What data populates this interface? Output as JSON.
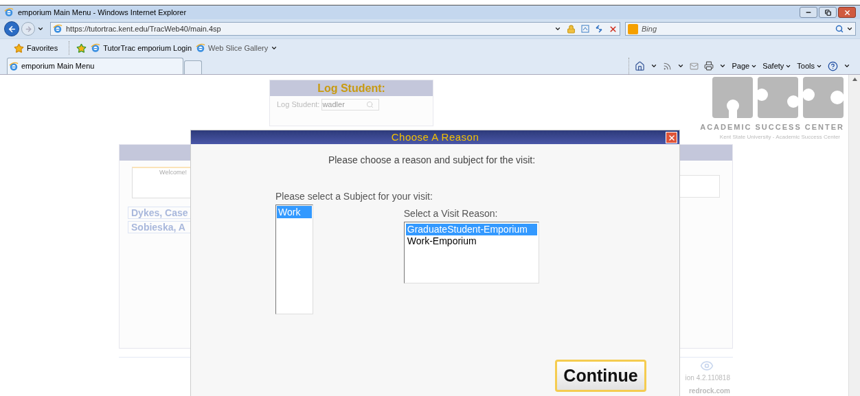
{
  "window": {
    "title": "emporium Main Menu - Windows Internet Explorer"
  },
  "address_bar": {
    "url": "https://tutortrac.kent.edu/TracWeb40/main.4sp",
    "search_placeholder": "Bing"
  },
  "favorites_bar": {
    "label": "Favorites",
    "links": [
      "TutorTrac emporium Login",
      "Web Slice Gallery"
    ]
  },
  "tabs": [
    {
      "label": "emporium Main Menu",
      "selected": true
    }
  ],
  "command_bar": [
    "Page",
    "Safety",
    "Tools"
  ],
  "page": {
    "log_student": {
      "title": "Log Student:",
      "label": "Log Student:",
      "value": "wadler"
    },
    "logo": {
      "title": "ACADEMIC SUCCESS CENTER",
      "subtitle": "Kent State University - Academic Success Center"
    },
    "welcome": "Welcome!",
    "students": [
      "Dykes, Case",
      "Sobieska, A"
    ],
    "version": "ion 4.2.110818",
    "footer_link": "redrock.com"
  },
  "dialog": {
    "title": "Choose A Reason",
    "prompt": "Please choose a reason and subject for the visit:",
    "subject_label": "Please select a Subject for your visit:",
    "subjects": [
      {
        "label": "Work",
        "selected": true
      }
    ],
    "reason_label": "Select a Visit Reason:",
    "reasons": [
      {
        "label": "GraduateStudent-Emporium",
        "selected": true
      },
      {
        "label": "Work-Emporium",
        "selected": false
      }
    ],
    "continue_button": "Continue"
  }
}
